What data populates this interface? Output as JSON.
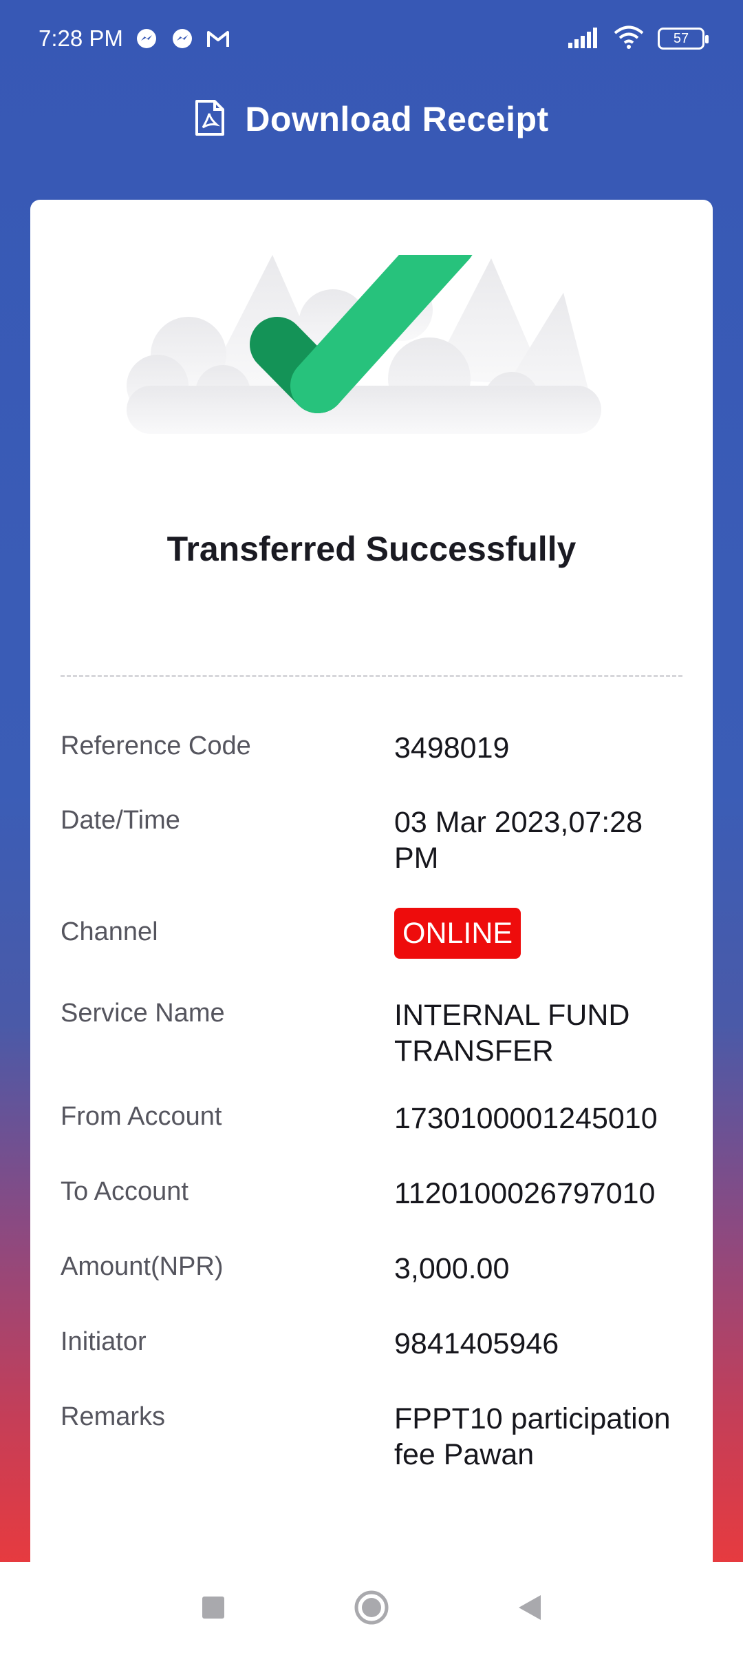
{
  "status_bar": {
    "time": "7:28 PM",
    "icons": [
      "messenger-icon",
      "messenger-icon",
      "gmail-icon"
    ],
    "right_icons": [
      "signal-icon",
      "wifi-icon",
      "battery-icon"
    ],
    "battery_level": "57"
  },
  "header": {
    "icon": "pdf-file-icon",
    "title": "Download Receipt"
  },
  "receipt": {
    "status_title": "Transferred Successfully",
    "rows": [
      {
        "label": "Reference Code",
        "value": "3498019"
      },
      {
        "label": "Date/Time",
        "value": "03 Mar 2023,07:28 PM"
      },
      {
        "label": "Channel",
        "value": "ONLINE"
      },
      {
        "label": "Service Name",
        "value": "INTERNAL FUND TRANSFER"
      },
      {
        "label": "From Account",
        "value": "1730100001245010"
      },
      {
        "label": "To Account",
        "value": "1120100026797010"
      },
      {
        "label": "Amount(NPR)",
        "value": "3,000.00"
      },
      {
        "label": "Initiator",
        "value": "9841405946"
      },
      {
        "label": "Remarks",
        "value": "FPPT10 participation fee Pawan"
      }
    ]
  },
  "colors": {
    "gradient_top": "#3758b5",
    "gradient_bottom": "#ee3a3a",
    "check_light": "#27c27c",
    "check_dark": "#149357",
    "channel_badge": "#ee0c0c"
  },
  "nav_bar": {
    "buttons": [
      "recents-square-icon",
      "home-circle-icon",
      "back-triangle-icon"
    ]
  }
}
